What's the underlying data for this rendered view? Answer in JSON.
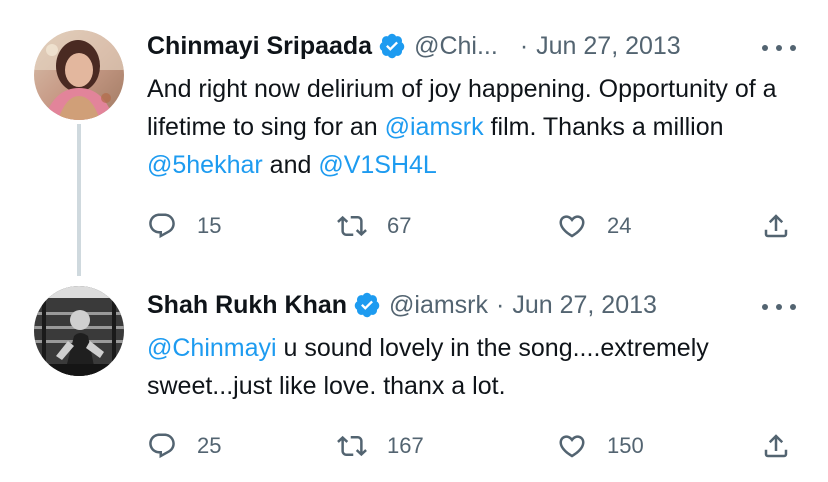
{
  "tweets": [
    {
      "author_name": "Chinmayi Sripaada",
      "handle": "@Chi...",
      "separator": "·",
      "date": "Jun 27, 2013",
      "text_parts": {
        "p1": "And right now delirium of joy happening. Opportunity of a lifetime to sing for an ",
        "m1": "@iamsrk",
        "p2": " film. Thanks a million ",
        "m2": "@5hekhar",
        "p3": " and ",
        "m3": "@V1SH4L"
      },
      "replies": "15",
      "retweets": "67",
      "likes": "24",
      "avatar_icon": "avatar-photo"
    },
    {
      "author_name": "Shah Rukh Khan",
      "handle": "@iamsrk",
      "separator": "·",
      "date": "Jun 27, 2013",
      "text_parts": {
        "m1": "@Chinmayi",
        "p1": " u sound lovely in the song....extremely sweet...just like love. thanx a lot."
      },
      "replies": "25",
      "retweets": "167",
      "likes": "150",
      "avatar_icon": "avatar-photo"
    }
  ],
  "icons": {
    "verified": "verified-badge-icon",
    "reply": "reply-icon",
    "retweet": "retweet-icon",
    "like": "heart-icon",
    "share": "share-icon",
    "more": "more-icon"
  },
  "colors": {
    "accent": "#1d9bf0",
    "text": "#0f1419",
    "secondary": "#536471",
    "thread_line": "#cfd9de"
  }
}
